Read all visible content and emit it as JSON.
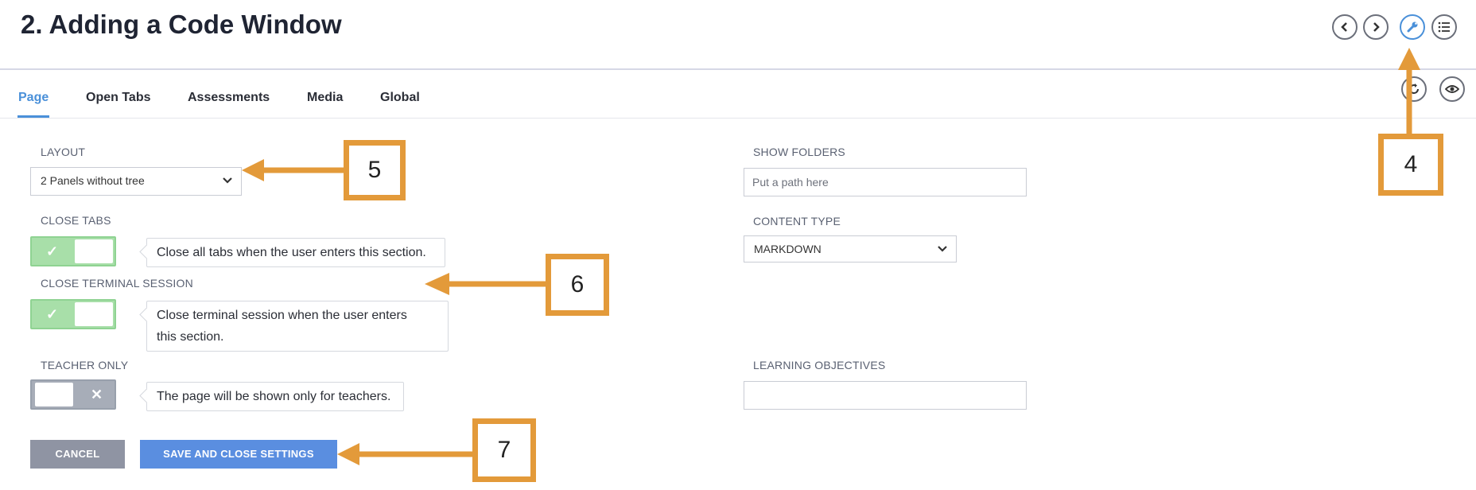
{
  "header": {
    "title": "2. Adding a Code Window"
  },
  "tabs": [
    {
      "label": "Page"
    },
    {
      "label": "Open Tabs"
    },
    {
      "label": "Assessments"
    },
    {
      "label": "Media"
    },
    {
      "label": "Global"
    }
  ],
  "left": {
    "layout": {
      "label": "LAYOUT",
      "value": "2 Panels without tree"
    },
    "close_tabs": {
      "label": "CLOSE TABS",
      "on": true,
      "tip": "Close all tabs when the user enters this section."
    },
    "close_terminal": {
      "label": "CLOSE TERMINAL SESSION",
      "on": true,
      "tip_line1": "Close terminal session when the user enters",
      "tip_line2": "this section."
    },
    "teacher_only": {
      "label": "TEACHER ONLY",
      "on": false,
      "tip": "The page will be shown only for teachers."
    }
  },
  "right": {
    "show_folders": {
      "label": "SHOW FOLDERS",
      "placeholder": "Put a path here"
    },
    "content_type": {
      "label": "CONTENT TYPE",
      "value": "MARKDOWN"
    },
    "learning_objectives": {
      "label": "LEARNING OBJECTIVES",
      "value": ""
    }
  },
  "buttons": {
    "cancel": "CANCEL",
    "save": "SAVE AND CLOSE SETTINGS"
  },
  "callouts": {
    "c4": "4",
    "c5": "5",
    "c6": "6",
    "c7": "7"
  },
  "colors": {
    "accent": "#4a90d9",
    "toggle_on": "#a8dfa9",
    "toggle_off": "#a7adb8",
    "save": "#5a8ee0",
    "cancel": "#8f94a3",
    "callout": "#e39a3a"
  },
  "icons": [
    "chevron-left-icon",
    "chevron-right-icon",
    "wrench-icon",
    "list-icon",
    "refresh-icon",
    "eye-icon",
    "chevron-down-icon",
    "check-icon",
    "x-icon"
  ]
}
